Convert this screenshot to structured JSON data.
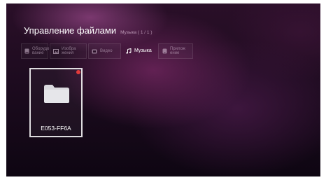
{
  "header": {
    "title": "Управление файлами",
    "subtitle": "Музыка ( 1 / 1 )"
  },
  "tabs": [
    {
      "label": "Оборудо\nвание",
      "icon": "storage-icon",
      "active": false
    },
    {
      "label": "Изобра\nжения",
      "icon": "image-icon",
      "active": false
    },
    {
      "label": "Видео",
      "icon": "video-icon",
      "active": false
    },
    {
      "label": "Музыка",
      "icon": "music-icon",
      "active": true
    },
    {
      "label": "Прилож\nение",
      "icon": "app-icon",
      "active": false
    }
  ],
  "files": [
    {
      "name": "E053-FF6A",
      "icon": "folder-icon",
      "badge": true
    }
  ],
  "colors": {
    "background": "#2a0f28",
    "badge": "#e23b3b",
    "folder": "#d9d9de",
    "text": "#ffffff"
  }
}
